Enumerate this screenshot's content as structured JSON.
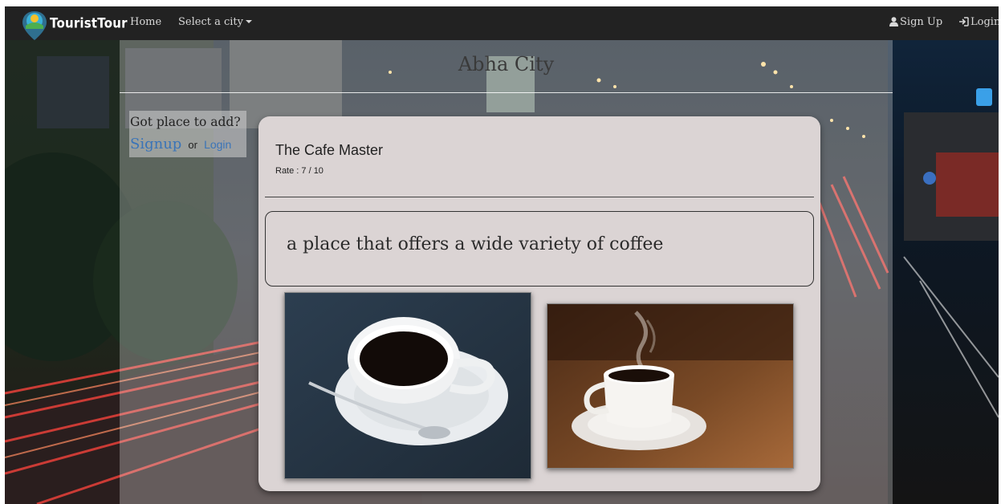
{
  "navbar": {
    "brand": "TouristTour",
    "links": {
      "home": "Home",
      "select_city": "Select a city",
      "sign_up": "Sign Up",
      "login": "Login"
    },
    "icons": [
      "logo-icon",
      "caret-down-icon",
      "user-icon",
      "login-icon"
    ]
  },
  "page": {
    "city_title": "Abha City"
  },
  "sidebar": {
    "prompt": "Got place to add?",
    "signup": "Signup",
    "or": "or",
    "login": "Login"
  },
  "place": {
    "name": "The Cafe Master",
    "rate": "Rate : 7 / 10",
    "description": "a place that offers a wide variety of coffee",
    "photos": [
      "coffee-cup-with-spoon-photo",
      "steaming-coffee-cup-photo"
    ]
  },
  "colors": {
    "navbar_bg": "#222222",
    "link_blue": "#3a74b8",
    "card_bg": "#dbd4d4"
  }
}
